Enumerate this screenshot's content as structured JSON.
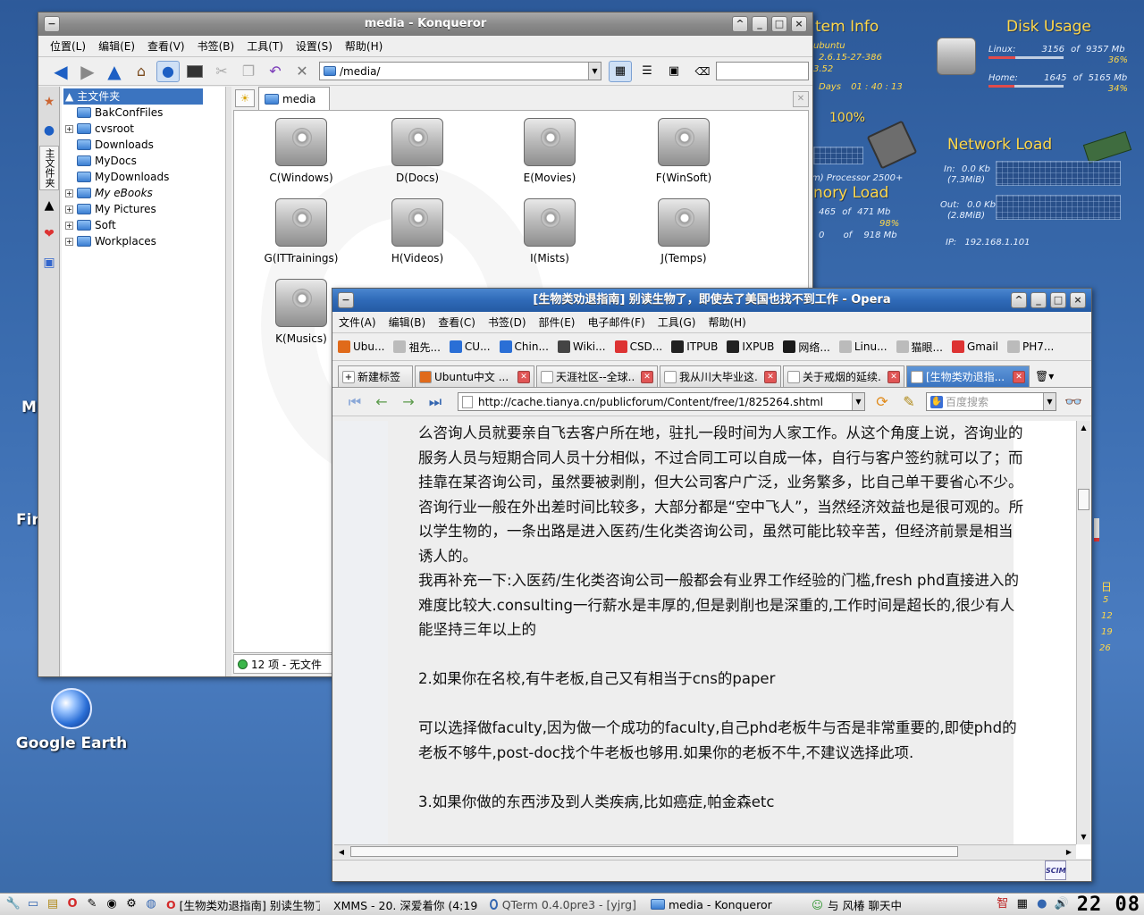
{
  "desktop": {
    "system_info": {
      "title": "tem Info",
      "os": "ubuntu",
      "kernel": "2.6.15-27-386",
      "version": "3.52",
      "uptime_label": "Days",
      "uptime_value": "01 : 40 : 13",
      "cpu_percent": "100%",
      "cpu_name": "m) Processor 2500+"
    },
    "disk_usage": {
      "title": "Disk Usage",
      "rows": [
        {
          "label": "Linux:",
          "used": "3156",
          "of": "of",
          "total": "9357 Mb",
          "percent": "36%",
          "fill": 0.36
        },
        {
          "label": "Home:",
          "used": "1645",
          "of": "of",
          "total": "5165 Mb",
          "percent": "34%",
          "fill": 0.34
        }
      ]
    },
    "memory": {
      "title": "nory Load",
      "ram_used": "465",
      "ram_of": "of",
      "ram_total": "471 Mb",
      "ram_percent": "98%",
      "swap_used": "0",
      "swap_of": "of",
      "swap_total": "918 Mb"
    },
    "network": {
      "title": "Network Load",
      "in_label": "In:",
      "in_rate": "0.0 Kb",
      "in_total": "(7.3MiB)",
      "out_label": "Out:",
      "out_rate": "0.0 Kb",
      "out_total": "(2.8MiB)",
      "ip_label": "IP:",
      "ip": "192.168.1.101"
    },
    "calendar": {
      "day": "日",
      "dates": [
        "5",
        "12",
        "19",
        "26"
      ]
    },
    "icons": {
      "google_earth": "Google Earth",
      "partial_m": "M",
      "partial_fir": "Fir"
    }
  },
  "konqueror": {
    "title": "media - Konqueror",
    "menu": [
      "位置(L)",
      "编辑(E)",
      "查看(V)",
      "书签(B)",
      "工具(T)",
      "设置(S)",
      "帮助(H)"
    ],
    "location": "/media/",
    "sidebar_root": "主文件夹",
    "sidebar_vertical_tab": "主文件夹",
    "tree": [
      {
        "label": "BakConfFiles",
        "expandable": false,
        "italic": false
      },
      {
        "label": "cvsroot",
        "expandable": true,
        "italic": false
      },
      {
        "label": "Downloads",
        "expandable": false,
        "italic": false
      },
      {
        "label": "MyDocs",
        "expandable": false,
        "italic": false
      },
      {
        "label": "MyDownloads",
        "expandable": false,
        "italic": false
      },
      {
        "label": "My eBooks",
        "expandable": true,
        "italic": true
      },
      {
        "label": "My Pictures",
        "expandable": true,
        "italic": false
      },
      {
        "label": "Soft",
        "expandable": true,
        "italic": false
      },
      {
        "label": "Workplaces",
        "expandable": true,
        "italic": false
      }
    ],
    "tab_label": "media",
    "drives": [
      "C(Windows)",
      "D(Docs)",
      "E(Movies)",
      "F(WinSoft)",
      "G(ITTrainings)",
      "H(Videos)",
      "I(Mists)",
      "J(Temps)",
      "K(Musics)"
    ],
    "status": "12 项 - 无文件"
  },
  "opera": {
    "title": "[生物类劝退指南] 别读生物了，即使去了美国也找不到工作 - Opera",
    "menu": [
      "文件(A)",
      "编辑(B)",
      "查看(C)",
      "书签(D)",
      "部件(E)",
      "电子邮件(F)",
      "工具(G)",
      "帮助(H)"
    ],
    "bookmarks": [
      "Ubu...",
      "祖先...",
      "CU...",
      "Chin...",
      "Wiki...",
      "CSD...",
      "ITPUB",
      "IXPUB",
      "网络...",
      "Linu...",
      "猫眼...",
      "Gmail",
      "PH7..."
    ],
    "bookmark_icons": [
      "ubuntu-icon",
      "page-icon",
      "cu-icon",
      "cu-icon",
      "wiki-icon",
      "csdn-icon",
      "itpub-icon",
      "ixpub-icon",
      "netbook-icon",
      "page-icon",
      "page-icon",
      "gmail-icon",
      "page-icon"
    ],
    "new_tab_label": "新建标签",
    "tabs": [
      "Ubuntu中文 ...",
      "天涯社区--全球...",
      "我从川大毕业这...",
      "关于戒烟的延续...",
      "[生物类劝退指..."
    ],
    "url": "http://cache.tianya.cn/publicforum/Content/free/1/825264.shtml",
    "search_placeholder": "百度搜索",
    "paragraphs": [
      "么咨询人员就要亲自飞去客户所在地，驻扎一段时间为人家工作。从这个角度上说，咨询业的服务人员与短期合同人员十分相似，不过合同工可以自成一体，自行与客户签约就可以了；而挂靠在某咨询公司，虽然要被剥削，但大公司客户广泛，业务繁多，比自己单干要省心不少。咨询行业一般在外出差时间比较多，大部分都是“空中飞人”，当然经济效益也是很可观的。所以学生物的，一条出路是进入医药/生化类咨询公司，虽然可能比较辛苦，但经济前景是相当诱人的。",
      "我再补充一下:入医药/生化类咨询公司一般都会有业界工作经验的门槛,fresh phd直接进入的难度比较大.consulting一行薪水是丰厚的,但是剥削也是深重的,工作时间是超长的,很少有人能坚持三年以上的",
      "",
      "2.如果你在名校,有牛老板,自己又有相当于cns的paper",
      "",
      "可以选择做faculty,因为做一个成功的faculty,自己phd老板牛与否是非常重要的,即使phd的老板不够牛,post-doc找个牛老板也够用.如果你的老板不牛,不建议选择此项.",
      "",
      "3.如果你做的东西涉及到人类疾病,比如癌症,帕金森etc"
    ],
    "status_icon_text": "SCIM"
  },
  "taskbar": {
    "tasks": [
      "[生物类劝退指南] 别读生物了",
      "XMMS - 20. 深爱着你 (4:19",
      "QTerm 0.4.0pre3 - [yjrg]",
      "media - Konqueror",
      "与 风椿 聊天中"
    ],
    "tray_text": "智",
    "clock": "22 08"
  }
}
